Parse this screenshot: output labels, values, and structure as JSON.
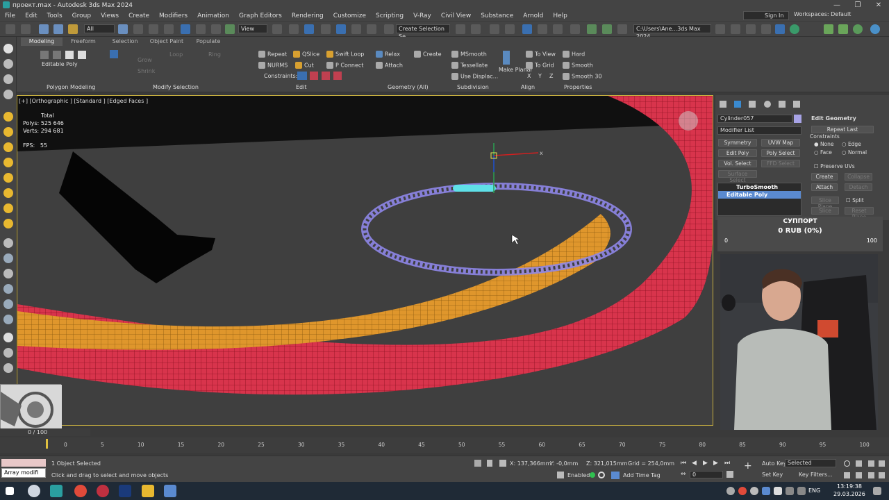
{
  "window": {
    "title": "проект.max - Autodesk 3ds Max 2024",
    "minimize": "—",
    "restore": "❐",
    "close": "✕"
  },
  "menu": [
    "File",
    "Edit",
    "Tools",
    "Group",
    "Views",
    "Create",
    "Modifiers",
    "Animation",
    "Graph Editors",
    "Rendering",
    "Customize",
    "Scripting",
    "V-Ray",
    "Civil View",
    "Substance",
    "Arnold",
    "Help"
  ],
  "signin": "Sign In",
  "workspaces": "Workspaces: Default",
  "toolbar": {
    "filter": "All",
    "refcoord": "View",
    "selection_set": "Create Selection Se",
    "path": "C:\\Users\\Ane...3ds Max 2024"
  },
  "ribbon": {
    "tabs": [
      "Modeling",
      "Freeform",
      "Selection",
      "Object Paint",
      "Populate"
    ],
    "editable_poly": "Editable Poly",
    "grow": "Grow",
    "shrink": "Shrink",
    "loop": "Loop",
    "ring": "Ring",
    "repeat": "Repeat",
    "qslice": "QSlice",
    "swift_loop": "Swift Loop",
    "nurms": "NURMS",
    "cut": "Cut",
    "p_connect": "P Connect",
    "constraints": "Constraints:",
    "relax": "Relax",
    "create": "Create",
    "attach": "Attach",
    "msmooth": "MSmooth",
    "tessellate": "Tessellate",
    "use_displac": "Use Displac...",
    "make_planar": "Make Planar",
    "to_view": "To View",
    "to_grid": "To Grid",
    "x": "X",
    "y": "Y",
    "z": "Z",
    "hard": "Hard",
    "smooth": "Smooth",
    "smooth30": "Smooth 30",
    "groups": {
      "polygon_modeling": "Polygon Modeling",
      "modify_selection": "Modify Selection",
      "edit": "Edit",
      "geometry_all": "Geometry (All)",
      "subdivision": "Subdivision",
      "align": "Align",
      "properties": "Properties"
    }
  },
  "viewport": {
    "label": "[+] [Orthographic ] [Standard ] [Edged Faces ]",
    "stats_total": "Total",
    "polys_label": "Polys:",
    "polys_value": "525 646",
    "verts_label": "Verts:",
    "verts_value": "294 681",
    "fps_label": "FPS:",
    "fps_value": "55",
    "gizmo_x": "x"
  },
  "cmdpanel": {
    "object_name": "Cylinder057",
    "modifier_list": "Modifier List",
    "symmetry": "Symmetry",
    "uvw_map": "UVW Map",
    "edit_poly": "Edit Poly",
    "poly_select": "Poly Select",
    "vol_select": "Vol. Select",
    "ffd_select": "FFD Select",
    "surface_select": "Surface Select",
    "stack": [
      "TurboSmooth",
      "Editable Poly"
    ],
    "edit_geometry": "Edit Geometry",
    "repeat_last": "Repeat Last",
    "constraints": "Constraints",
    "c_none": "None",
    "c_edge": "Edge",
    "c_face": "Face",
    "c_normal": "Normal",
    "preserve_uvs": "Preserve UVs",
    "create": "Create",
    "collapse": "Collapse",
    "attach": "Attach",
    "detach": "Detach",
    "slice_plane": "Slice Plane",
    "split": "Split",
    "slice": "Slice",
    "reset_plane": "Reset Plane"
  },
  "support": {
    "title": "СУППОРТ",
    "amount": "0 RUB (0%)",
    "min": "0",
    "max": "100"
  },
  "timeline": {
    "frame": "0 / 100",
    "ticks": [
      "0",
      "5",
      "10",
      "15",
      "20",
      "25",
      "30",
      "35",
      "40",
      "45",
      "50",
      "55",
      "60",
      "65",
      "70",
      "75",
      "80",
      "85",
      "90",
      "95",
      "100"
    ]
  },
  "status": {
    "maxscript": "Array modifi",
    "objects_selected": "1 Object Selected",
    "prompt": "Click and drag to select and move objects",
    "x_label": "X:",
    "x_value": "137,366mm",
    "y_label": "Y:",
    "y_value": "-0,0mm",
    "z_label": "Z:",
    "z_value": "321,015mm",
    "grid": "Grid = 254,0mm",
    "enabled": "Enabled:",
    "add_time_tag": "Add Time Tag",
    "auto_key": "Auto Key",
    "selected": "Selected",
    "set_key": "Set Key",
    "key_filters": "Key Filters...",
    "frame_field": "0"
  },
  "taskbar": {
    "lang": "ENG",
    "time": "13:19:38",
    "date": "29.03.2026"
  },
  "colors": {
    "accent_blue": "#2f7fd8",
    "ring_red": "#e0344f",
    "ring_orange": "#e0962a",
    "selection_wire": "#8e86e8"
  }
}
